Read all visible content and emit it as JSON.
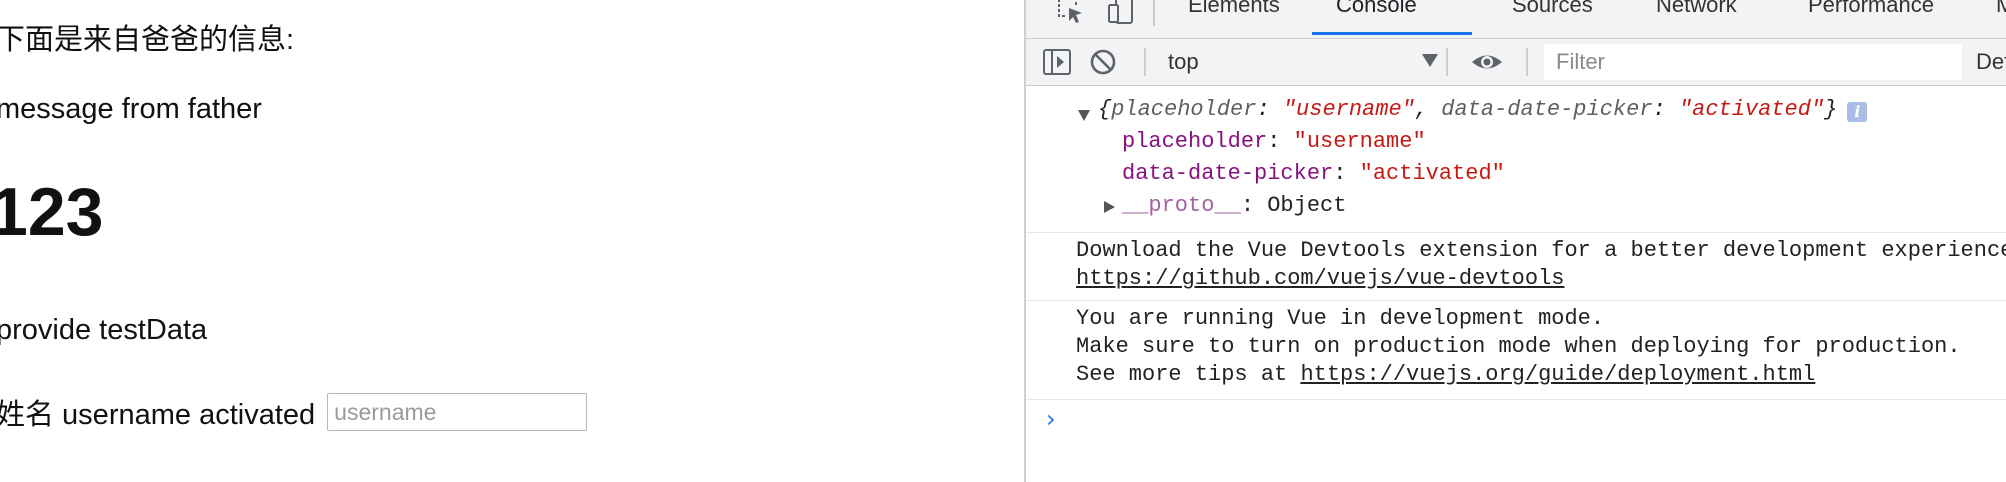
{
  "page": {
    "line1": "下面是来自爸爸的信息:",
    "line2": "message from father",
    "big_number": "123",
    "line4": "provide testData",
    "name_label": "姓名 username activated",
    "name_input_placeholder": "username"
  },
  "devtools": {
    "tabs": [
      {
        "label": "Elements"
      },
      {
        "label": "Console"
      },
      {
        "label": "Sources"
      },
      {
        "label": "Network"
      },
      {
        "label": "Performance"
      },
      {
        "label": "Memory"
      }
    ],
    "active_tab": "Console",
    "accent_color": "#1a73e8",
    "toolbar": {
      "context": "top",
      "filter_placeholder": "Filter",
      "levels": "Default levels"
    },
    "console": {
      "object_summary": {
        "open": "{",
        "key1": "placeholder",
        "val1": "\"username\"",
        "key2": "data-date-picker",
        "val2": "\"activated\"",
        "close": "}",
        "info_badge": "i"
      },
      "object_props": [
        {
          "key": "placeholder",
          "value": "\"username\""
        },
        {
          "key": "data-date-picker",
          "value": "\"activated\""
        }
      ],
      "proto": {
        "key": "__proto__",
        "value": "Object"
      },
      "devtools_msg": "Download the Vue Devtools extension for a better development experience:",
      "devtools_link": "https://github.com/vuejs/vue-devtools",
      "dev_mode_lines": [
        "You are running Vue in development mode.",
        "Make sure to turn on production mode when deploying for production."
      ],
      "tips_prefix": "See more tips at ",
      "tips_link": "https://vuejs.org/guide/deployment.html",
      "prompt": "›"
    }
  }
}
